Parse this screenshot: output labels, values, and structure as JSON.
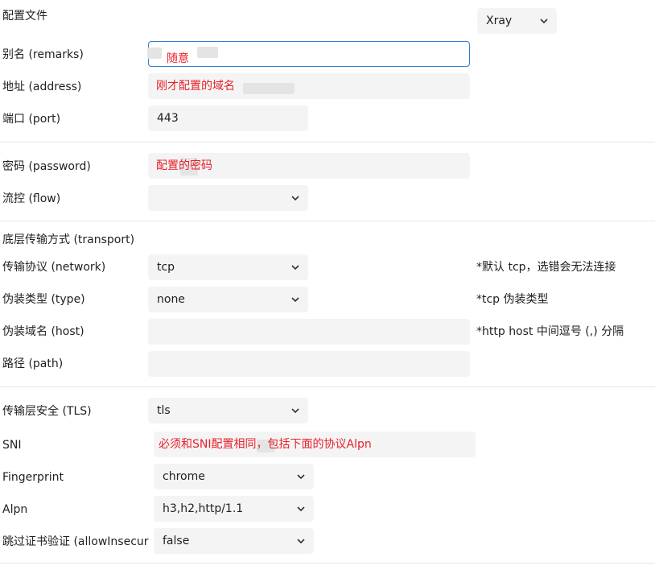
{
  "profile": {
    "label": "配置文件",
    "select_value": "Xray"
  },
  "remarks": {
    "label": "别名 (remarks)",
    "value": "随意"
  },
  "address": {
    "label": "地址 (address)",
    "value": "刚才配置的域名"
  },
  "port": {
    "label": "端口 (port)",
    "value": "443"
  },
  "password": {
    "label": "密码 (password)",
    "value": "配置的密码"
  },
  "flow": {
    "label": "流控 (flow)",
    "value": ""
  },
  "transport": {
    "title": "底层传输方式 (transport)"
  },
  "network": {
    "label": "传输协议 (network)",
    "value": "tcp",
    "note": "*默认 tcp，选错会无法连接"
  },
  "type": {
    "label": "伪装类型 (type)",
    "value": "none",
    "note": "*tcp 伪装类型"
  },
  "host": {
    "label": "伪装域名 (host)",
    "value": "",
    "note": "*http host 中间逗号 (,) 分隔"
  },
  "path": {
    "label": "路径 (path)",
    "value": ""
  },
  "tls": {
    "label": "传输层安全 (TLS)",
    "value": "tls"
  },
  "sni": {
    "label": "SNI",
    "value": "必须和SNI配置相同，包括下面的协议Alpn"
  },
  "fingerprint": {
    "label": "Fingerprint",
    "value": "chrome"
  },
  "alpn": {
    "label": "Alpn",
    "value": "h3,h2,http/1.1"
  },
  "allow_insecure": {
    "label": "跳过证书验证 (allowInsecure",
    "value": "false"
  },
  "colors": {
    "annotation_red": "#e8202a",
    "field_bg": "#f4f4f4",
    "focus_border": "#2f7fd6"
  }
}
